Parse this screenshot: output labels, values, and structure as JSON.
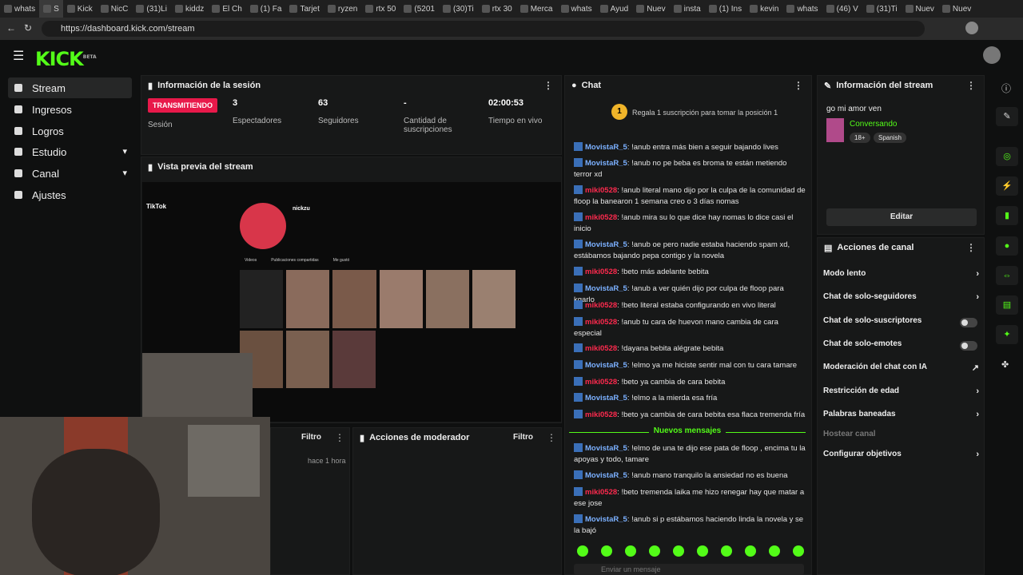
{
  "browser": {
    "tabs": [
      "whats",
      "S",
      "Kick",
      "NicC",
      "(31)Li",
      "kiddz",
      "El Ch",
      "(1) Fa",
      "Tarjet",
      "ryzen",
      "rtx 50",
      "(5201",
      "(30)Ti",
      "rtx 30",
      "Merca",
      "whats",
      "Ayud",
      "Nuev",
      "insta",
      "(1) Ins",
      "kevin",
      "whats",
      "(46) V",
      "(31)Ti",
      "Nuev",
      "Nuev"
    ],
    "url": "https://dashboard.kick.com/stream"
  },
  "brand": {
    "logo": "KICK",
    "beta": "BETA",
    "accent": "#53fc18"
  },
  "sidebar": {
    "items": [
      {
        "label": "Stream"
      },
      {
        "label": "Ingresos"
      },
      {
        "label": "Logros"
      },
      {
        "label": "Estudio"
      },
      {
        "label": "Canal"
      },
      {
        "label": "Ajustes"
      }
    ]
  },
  "session": {
    "title": "Información de la sesión",
    "status": "TRANSMITIENDO",
    "status_label": "Sesión",
    "stats": [
      {
        "value": "3",
        "label": "Espectadores"
      },
      {
        "value": "63",
        "label": "Seguidores"
      },
      {
        "value": "-",
        "label": "Cantidad de suscripciones"
      },
      {
        "value": "02:00:53",
        "label": "Tiempo en vivo"
      }
    ]
  },
  "preview": {
    "title": "Vista previa del stream",
    "site": "TikTok",
    "profile_name": "nickzu",
    "tabs": [
      "Videos",
      "Publicaciones compartidas",
      "Me gustó"
    ]
  },
  "bottom": {
    "filter1": "Filtro",
    "time": "hace 1 hora",
    "mod_title": "Acciones de moderador",
    "filter2": "Filtro"
  },
  "chat": {
    "title": "Chat",
    "gift_rank": "1",
    "gift_text": "Regala 1 suscripción para tomar la posición 1",
    "new_messages": "Nuevos mensajes",
    "input_placeholder": "Enviar un mensaje",
    "messages": [
      {
        "user": "MovistaR_5",
        "text": "!anub entra más bien a seguir bajando lives"
      },
      {
        "user": "MovistaR_5",
        "text": "!anub no pe beba es broma te están metiendo terror xd"
      },
      {
        "user": "miki0528",
        "text": "!anub literal mano dijo por la culpa de la comunidad de floop la banearon 1 semana creo o 3 días nomas"
      },
      {
        "user": "miki0528",
        "text": "!anub mira su lo que dice hay nomas lo dice casi el inicio"
      },
      {
        "user": "MovistaR_5",
        "text": "!anub oe pero nadie estaba haciendo spam xd, estábamos bajando pepa contigo y la novela"
      },
      {
        "user": "miki0528",
        "text": "!beto más adelante bebita"
      },
      {
        "user": "MovistaR_5",
        "text": "!anub a ver quién dijo por culpa de floop para kgarlo"
      },
      {
        "user": "miki0528",
        "text": "!beto literal estaba configurando en vivo literal"
      },
      {
        "user": "miki0528",
        "text": "!anub tu cara de huevon mano cambia de cara especial"
      },
      {
        "user": "miki0528",
        "text": "!dayana bebita alégrate bebita"
      },
      {
        "user": "MovistaR_5",
        "text": "!elmo ya me hiciste sentir mal con tu cara tamare"
      },
      {
        "user": "miki0528",
        "text": "!beto ya cambia de cara bebita"
      },
      {
        "user": "MovistaR_5",
        "text": "!elmo a la mierda esa fría"
      },
      {
        "user": "miki0528",
        "text": "!beto ya cambia de cara bebita esa flaca tremenda fría"
      },
      {
        "user": "MovistaR_5",
        "text": "!elmo de una te dijo ese pata de floop , encima tu la apoyas y todo, tamare"
      },
      {
        "user": "MovistaR_5",
        "text": "!anub mano tranquilo la ansiedad no es buena"
      },
      {
        "user": "miki0528",
        "text": "!beto tremenda laika me hizo renegar hay que matar a ese jose"
      },
      {
        "user": "MovistaR_5",
        "text": "!anub si p estábamos haciendo linda la novela y se la bajó"
      }
    ]
  },
  "stream_info": {
    "title": "Información del stream",
    "stream_title": "go mi amor ven",
    "category": "Conversando",
    "tags": [
      "18+",
      "Spanish"
    ],
    "edit": "Editar"
  },
  "channel_actions": {
    "title": "Acciones de canal",
    "items": [
      {
        "label": "Modo lento",
        "control": "chevron"
      },
      {
        "label": "Chat de solo-seguidores",
        "control": "chevron"
      },
      {
        "label": "Chat de solo-suscriptores",
        "control": "toggle"
      },
      {
        "label": "Chat de solo-emotes",
        "control": "toggle"
      },
      {
        "label": "Moderación del chat con IA",
        "control": "external"
      },
      {
        "label": "Restricción de edad",
        "control": "chevron"
      },
      {
        "label": "Palabras baneadas",
        "control": "chevron"
      },
      {
        "label": "Hostear canal",
        "control": "none"
      },
      {
        "label": "Configurar objetivos",
        "control": "chevron"
      }
    ]
  }
}
